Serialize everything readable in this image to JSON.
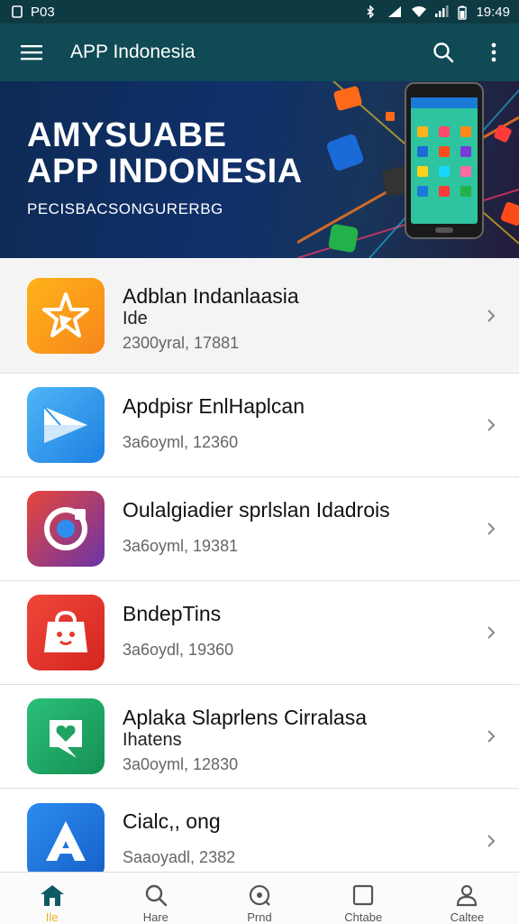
{
  "status_bar": {
    "left_text": "P03",
    "time": "19:49",
    "icons": [
      "sim-icon",
      "bluetooth-icon",
      "signal-icon",
      "wifi-icon",
      "signal-icon",
      "battery-icon"
    ]
  },
  "app_bar": {
    "title": "APP Indonesia",
    "icons": [
      "menu-icon",
      "search-icon",
      "more-vert-icon"
    ]
  },
  "banner": {
    "title_line1": "AMYSUABE",
    "title_line2": "APP INDONESIA",
    "subtitle": "PECISBACSONGURERBG"
  },
  "apps": [
    {
      "name": "Adblan Indanlaasia",
      "subtitle": "Ide",
      "meta": "2300yral, 17881",
      "icon": "star-icon",
      "color": "#f7a21b"
    },
    {
      "name": "Apdpisr EnlHaplcan",
      "subtitle": "",
      "meta": "3a6oyml, 12360",
      "icon": "play-icon",
      "color": "#2e96ea"
    },
    {
      "name": "Oulalgiadier sprlslan Idadrois",
      "subtitle": "",
      "meta": "3a6oyml, 19381",
      "icon": "camera-icon",
      "color": "#8b3a9a"
    },
    {
      "name": "BndepTins",
      "subtitle": "",
      "meta": "3a6oydl, 19360",
      "icon": "bag-icon",
      "color": "#e33a2c"
    },
    {
      "name": "Aplaka Slaprlens Cirralasa",
      "subtitle": "Ihatens",
      "meta": "3a0oyml, 12830",
      "icon": "heart-chat-icon",
      "color": "#1fa363"
    },
    {
      "name": "Cialc,, ong",
      "subtitle": "",
      "meta": "Saaoyadl, 2382",
      "icon": "a-letter-icon",
      "color": "#1a72d6"
    }
  ],
  "bottom_nav": [
    {
      "label": "Ile",
      "icon": "home-icon",
      "active": true
    },
    {
      "label": "Hare",
      "icon": "search-icon",
      "active": false
    },
    {
      "label": "Prnd",
      "icon": "discover-icon",
      "active": false
    },
    {
      "label": "Chtabe",
      "icon": "square-icon",
      "active": false
    },
    {
      "label": "Caltee",
      "icon": "profile-icon",
      "active": false
    }
  ],
  "colors": {
    "status_bar": "#0e3a44",
    "app_bar": "#0f4a55",
    "banner_bg": "#10306a",
    "nav_active": "#f2b21b"
  }
}
